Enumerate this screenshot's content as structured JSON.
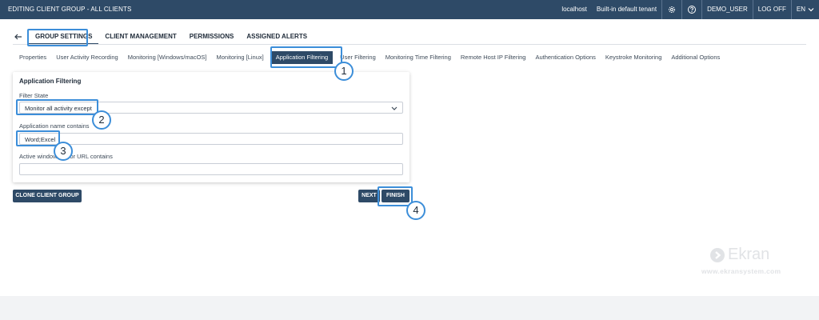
{
  "topbar": {
    "title": "EDITING CLIENT GROUP - ALL CLIENTS",
    "host": "localhost",
    "tenant": "Built-in default tenant",
    "user": "DEMO_USER",
    "logoff": "LOG OFF",
    "lang": "EN"
  },
  "main_tabs": [
    {
      "label": "GROUP SETTINGS"
    },
    {
      "label": "CLIENT MANAGEMENT"
    },
    {
      "label": "PERMISSIONS"
    },
    {
      "label": "ASSIGNED ALERTS"
    }
  ],
  "sub_tabs": [
    {
      "label": "Properties"
    },
    {
      "label": "User Activity Recording"
    },
    {
      "label": "Monitoring [Windows/macOS]"
    },
    {
      "label": "Monitoring [Linux]"
    },
    {
      "label": "Application Filtering"
    },
    {
      "label": "User Filtering"
    },
    {
      "label": "Monitoring Time Filtering"
    },
    {
      "label": "Remote Host IP Filtering"
    },
    {
      "label": "Authentication Options"
    },
    {
      "label": "Keystroke Monitoring"
    },
    {
      "label": "Additional Options"
    }
  ],
  "form": {
    "title": "Application Filtering",
    "filter_state_label": "Filter State",
    "filter_state_value": "Monitor all activity except",
    "app_name_label": "Application name contains",
    "app_name_value": "Word;Excel",
    "window_label": "Active window title or URL contains",
    "window_value": ""
  },
  "buttons": {
    "clone": "CLONE CLIENT GROUP",
    "next": "NEXT",
    "finish": "FINISH"
  },
  "callouts": [
    "1",
    "2",
    "3",
    "4"
  ],
  "brand": {
    "name": "Ekran",
    "url": "www.ekransystem.com"
  },
  "icons": [
    "gear-icon",
    "help-icon",
    "chevron-down-icon",
    "back-arrow-icon"
  ],
  "colors": {
    "header": "#2e4a67",
    "accent": "#3c8ed9"
  }
}
